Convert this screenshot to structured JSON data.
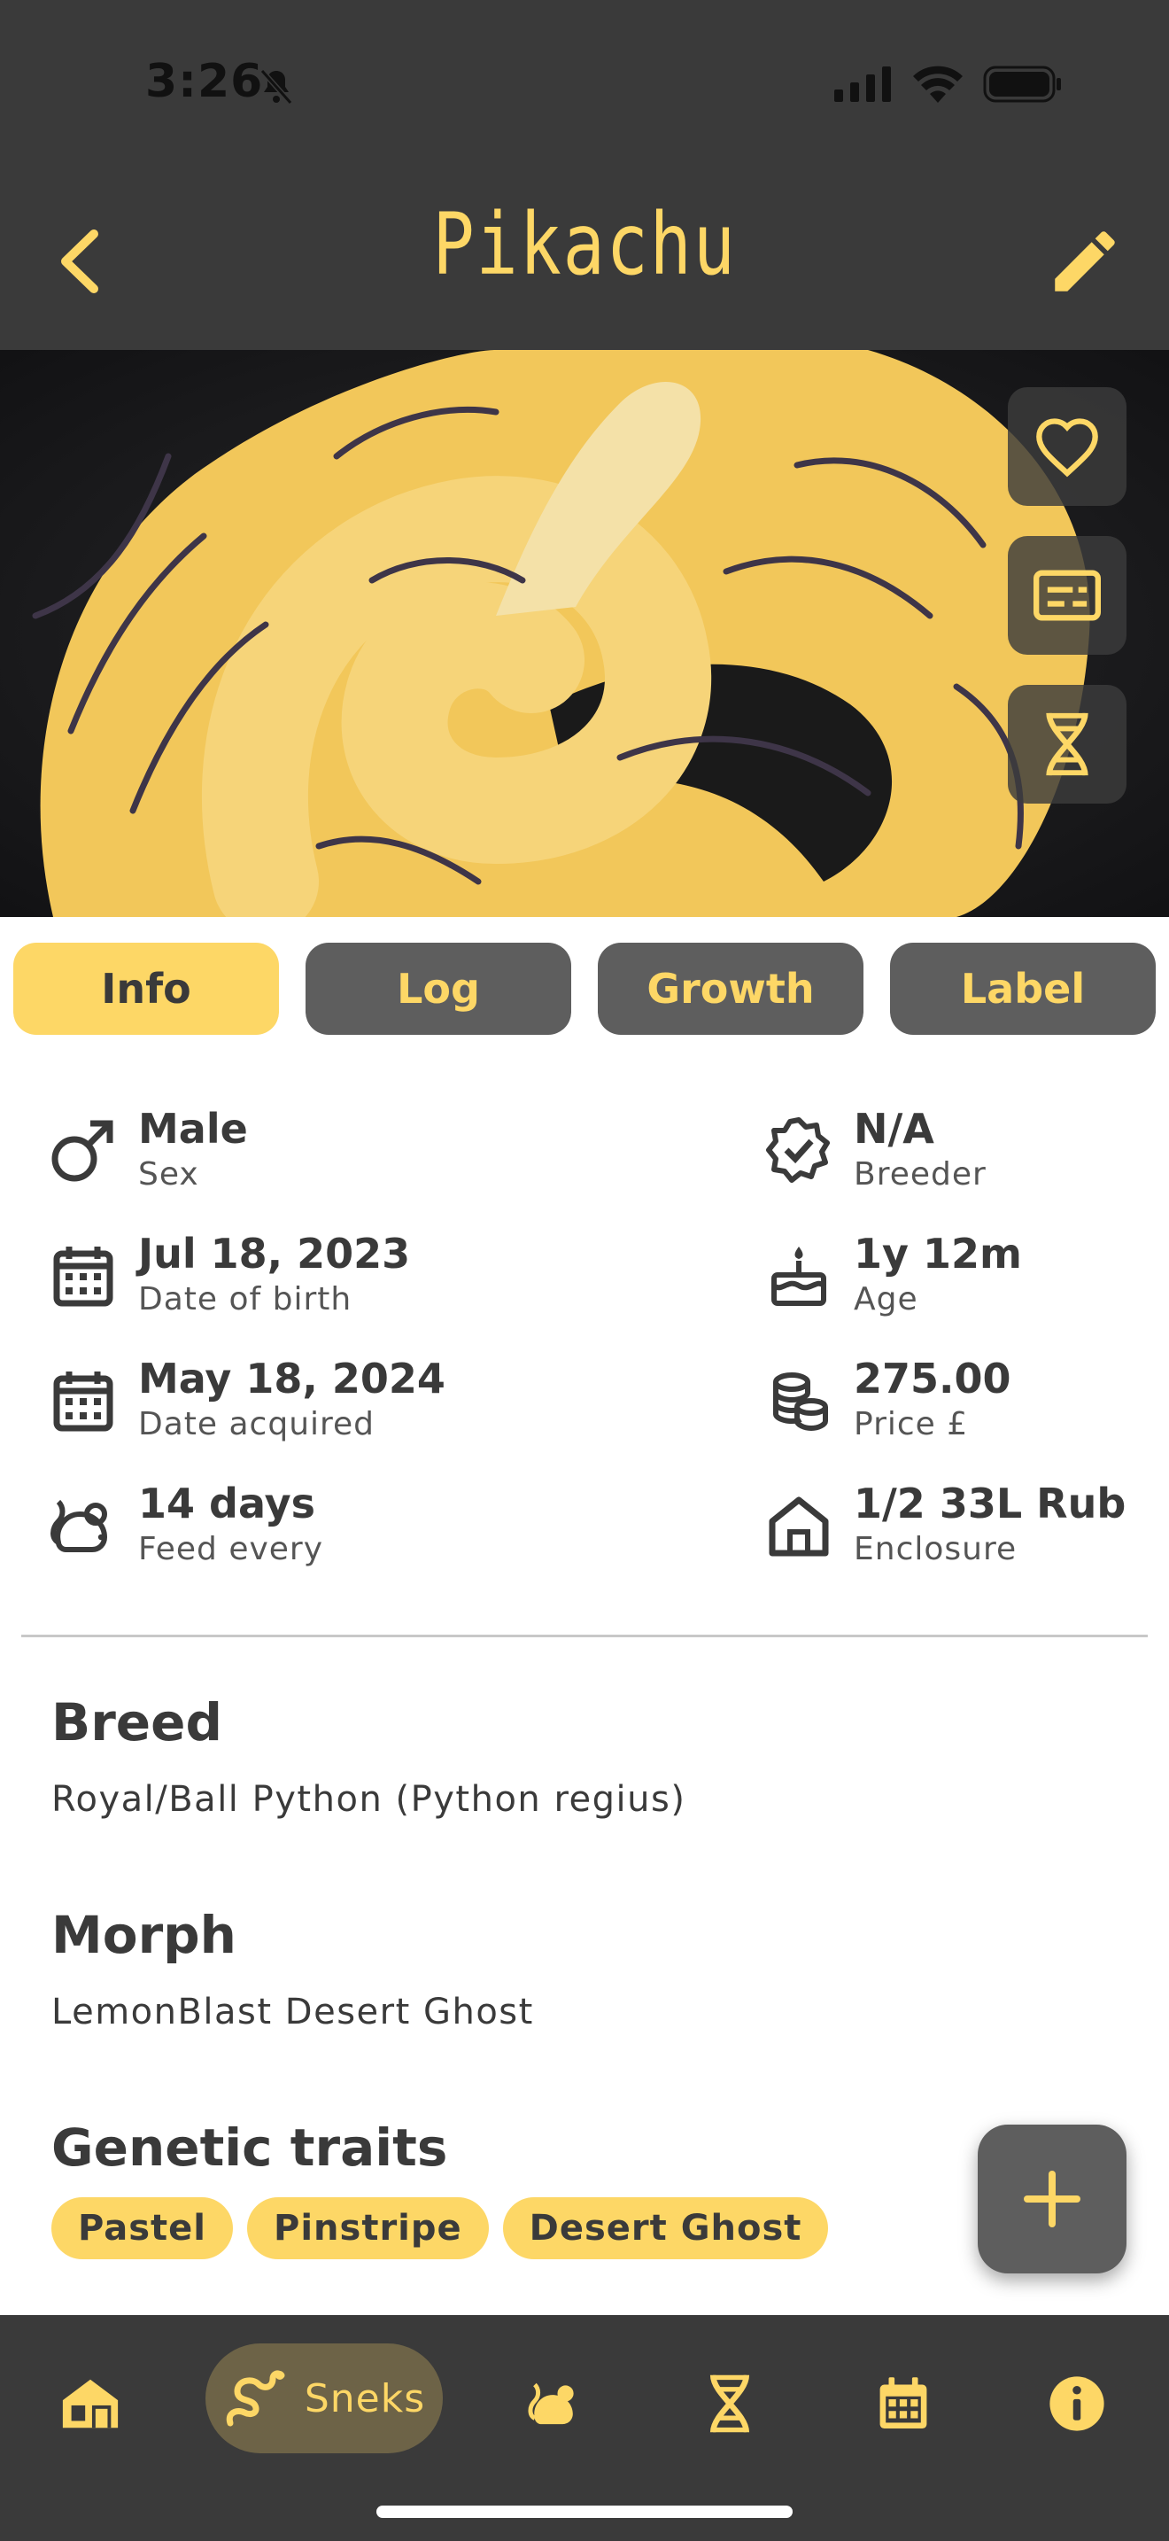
{
  "status_bar": {
    "time": "3:26"
  },
  "header": {
    "title": "Pikachu"
  },
  "tabs": [
    {
      "label": "Info",
      "active": true
    },
    {
      "label": "Log",
      "active": false
    },
    {
      "label": "Growth",
      "active": false
    },
    {
      "label": "Label",
      "active": false
    }
  ],
  "info": {
    "sex": {
      "value": "Male",
      "label": "Sex"
    },
    "breeder": {
      "value": "N/A",
      "label": "Breeder"
    },
    "dob": {
      "value": "Jul 18, 2023",
      "label": "Date of birth"
    },
    "age": {
      "value": "1y 12m",
      "label": "Age"
    },
    "acquired": {
      "value": "May 18, 2024",
      "label": "Date acquired"
    },
    "price": {
      "value": "275.00",
      "label": "Price £"
    },
    "feed": {
      "value": "14 days",
      "label": "Feed every"
    },
    "enclosure": {
      "value": "1/2 33L Rub",
      "label": "Enclosure"
    }
  },
  "breed": {
    "title": "Breed",
    "value": "Royal/Ball Python (Python regius)"
  },
  "morph": {
    "title": "Morph",
    "value": "LemonBlast Desert Ghost"
  },
  "genetics": {
    "title": "Genetic traits",
    "traits": [
      "Pastel",
      "Pinstripe",
      "Desert Ghost"
    ]
  },
  "bottom_nav": {
    "active_label": "Sneks"
  },
  "colors": {
    "accent": "#fdd766",
    "dark": "#3a3a3a",
    "tab_inactive": "#5e5e5e"
  }
}
